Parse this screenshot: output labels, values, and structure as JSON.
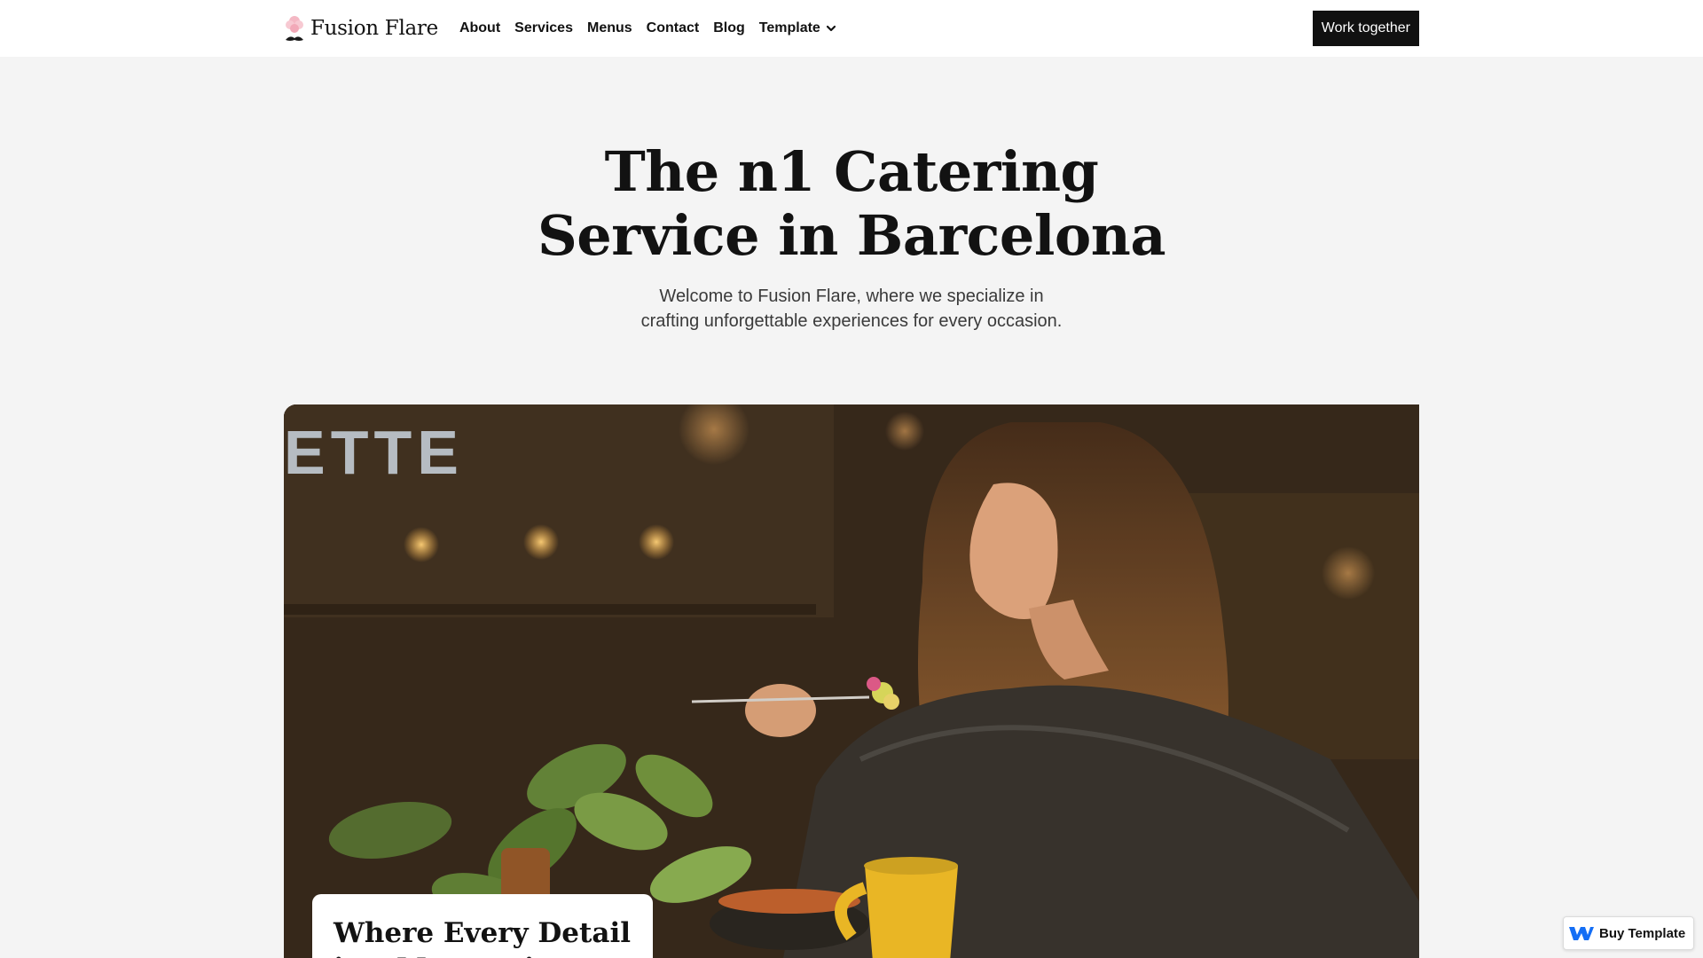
{
  "brand": {
    "name": "Fusion Flare",
    "logo_icon": "flower-icon"
  },
  "nav": {
    "links": [
      "About",
      "Services",
      "Menus",
      "Contact",
      "Blog"
    ],
    "dropdown_label": "Template",
    "dropdown_icon": "chevron-down-icon",
    "cta_label": "Work together"
  },
  "hero": {
    "title_line1": "The n1 Catering",
    "title_line2": "Service in Barcelona",
    "subtitle_line1": "Welcome to Fusion Flare, where we specialize in",
    "subtitle_line2": "crafting unforgettable experiences for every occasion."
  },
  "feature_card": {
    "title": "Where Every Detail is a Masterpiece"
  },
  "badge": {
    "label": "Buy Template",
    "icon": "webflow-icon"
  },
  "colors": {
    "background": "#f4f4f4",
    "nav_background": "#ffffff",
    "text": "#121212",
    "cta_background": "#111111",
    "cta_text": "#ffffff",
    "logo_accent": "#f4b8c4",
    "webflow_blue": "#146ef5"
  }
}
